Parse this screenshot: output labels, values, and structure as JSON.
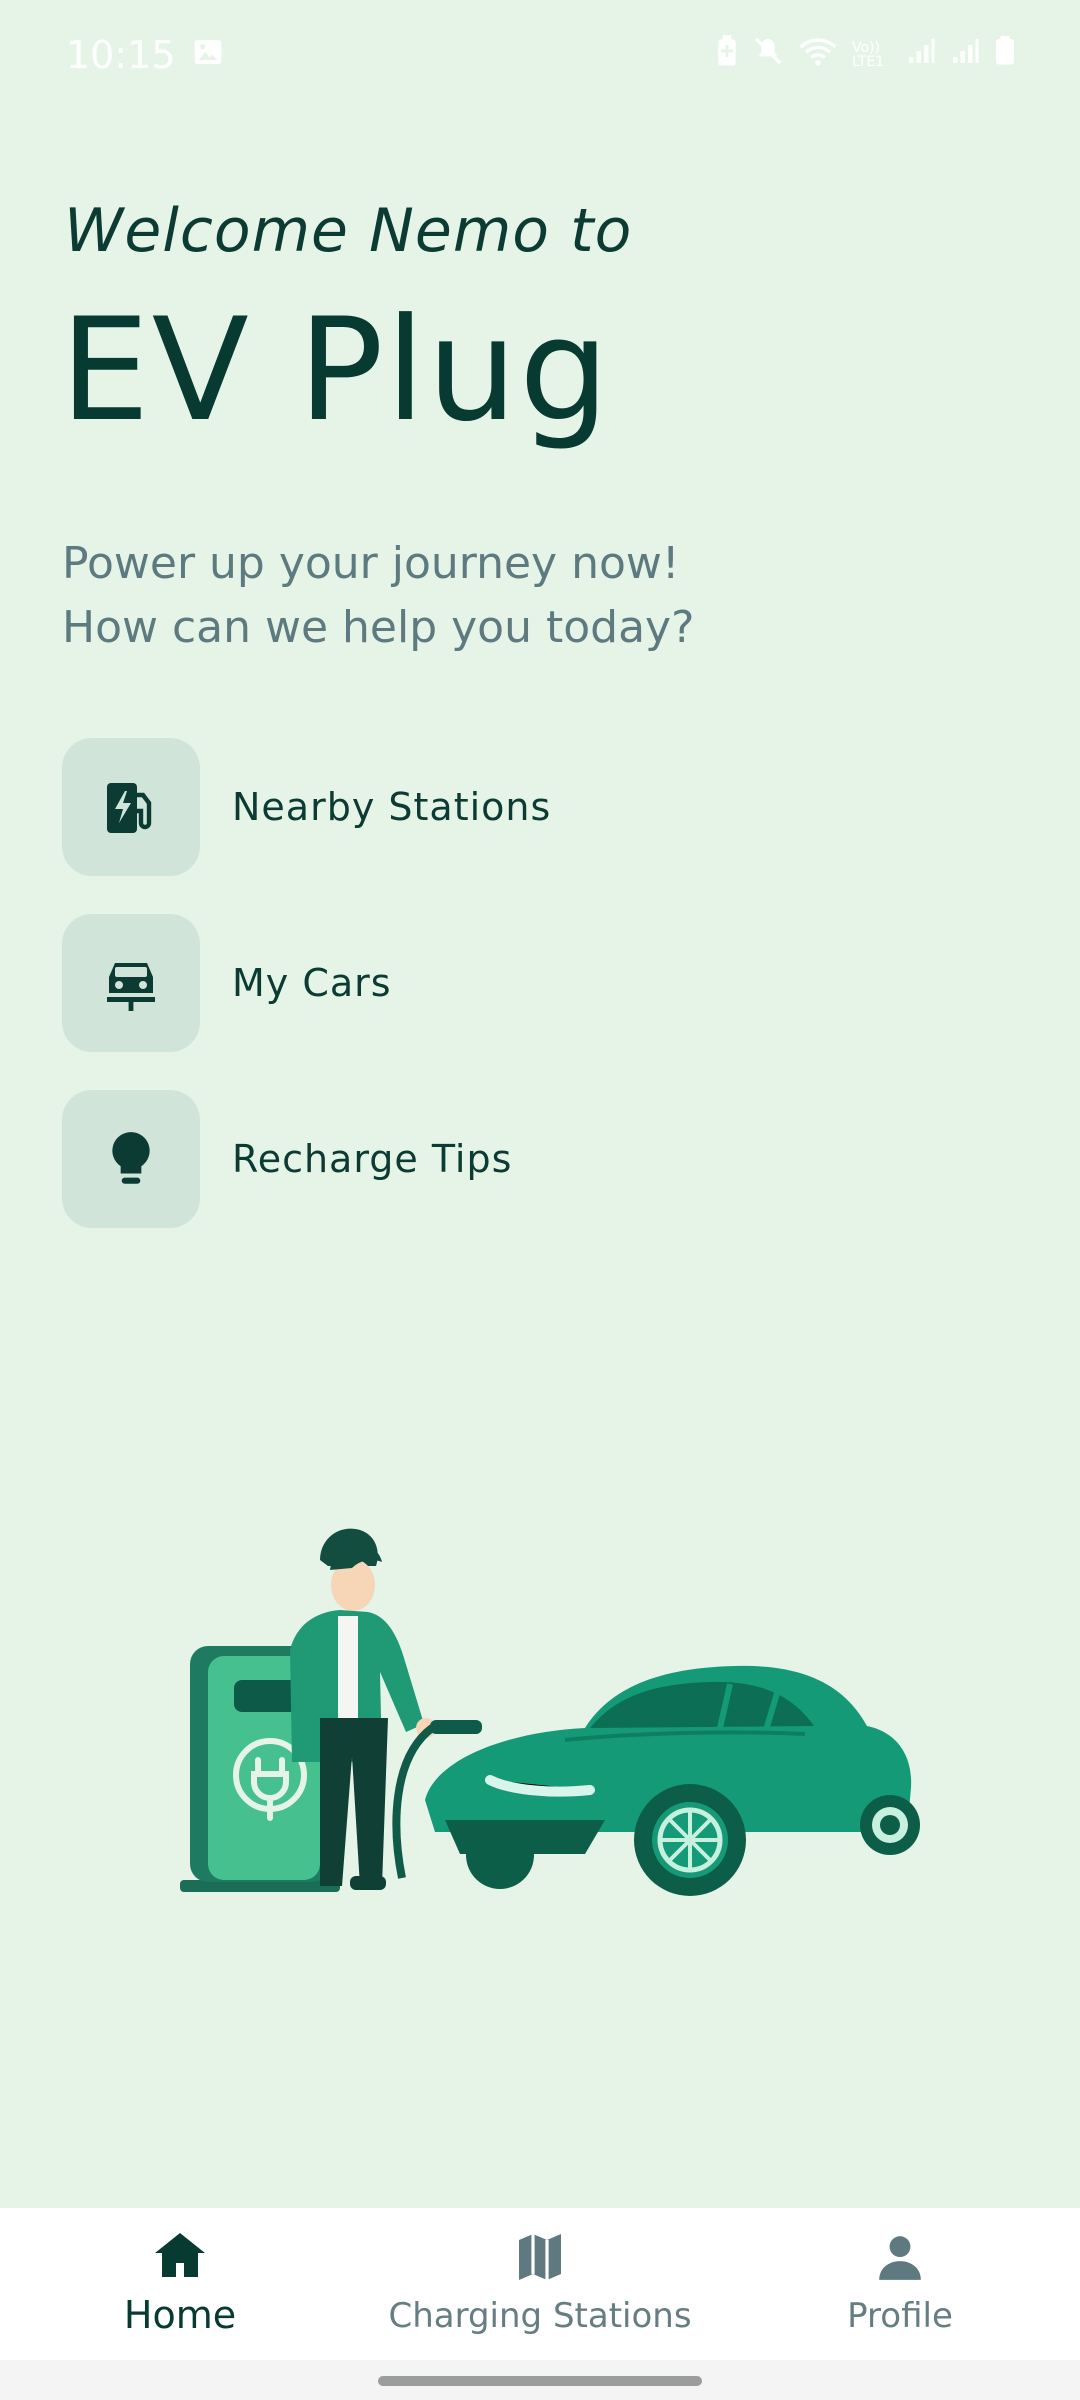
{
  "status": {
    "time": "10:15",
    "right_icons": [
      "battery-saver-icon",
      "mute-icon",
      "wifi-icon",
      "volte-icon",
      "signal-icon",
      "signal-icon",
      "battery-icon"
    ],
    "volte_text": "Vo)) LTE1"
  },
  "greeting": {
    "welcome": "Welcome Nemo to",
    "app_name": "EV Plug",
    "tagline_line1": "Power up your journey now!",
    "tagline_line2": "How can we help you today?"
  },
  "menu": [
    {
      "label": "Nearby Stations",
      "icon": "ev-station-icon"
    },
    {
      "label": "My Cars",
      "icon": "car-icon"
    },
    {
      "label": "Recharge Tips",
      "icon": "lightbulb-icon"
    }
  ],
  "nav": {
    "items": [
      {
        "label": "Home",
        "icon": "home-icon",
        "active": true
      },
      {
        "label": "Charging Stations",
        "icon": "map-icon",
        "active": false
      },
      {
        "label": "Profile",
        "icon": "person-icon",
        "active": false
      }
    ]
  },
  "colors": {
    "background": "#e6f4e8",
    "primary_dark": "#073a31",
    "accent_green": "#0e9a76",
    "icon_tile": "#d0e4da"
  }
}
